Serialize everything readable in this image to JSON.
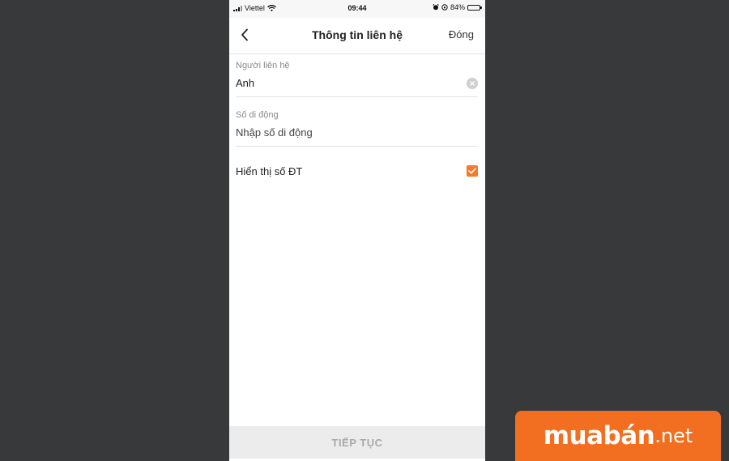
{
  "status_bar": {
    "carrier": "Viettel",
    "time": "09:44",
    "battery": "84%",
    "battery_level": 0.84,
    "icons": [
      "signal-icon",
      "wifi-icon",
      "alarm-icon",
      "orientation-lock-icon",
      "battery-icon"
    ]
  },
  "nav": {
    "title": "Thông tin liên hệ",
    "close_label": "Đóng",
    "back_icon": "chevron-left-icon"
  },
  "contact_field": {
    "label": "Người liên hệ",
    "value": "Anh",
    "clear_icon": "clear-icon"
  },
  "phone_field": {
    "label": "Số di động",
    "placeholder": "Nhập số di động",
    "value": ""
  },
  "show_phone": {
    "label": "Hiển thị số ĐT",
    "checked": true
  },
  "footer": {
    "continue_label": "TIẾP TỤC"
  },
  "brand": {
    "name": "muabán",
    "tld": ".net"
  },
  "colors": {
    "accent": "#f47a2c",
    "brand": "#f26f21",
    "background": "#38393a"
  }
}
